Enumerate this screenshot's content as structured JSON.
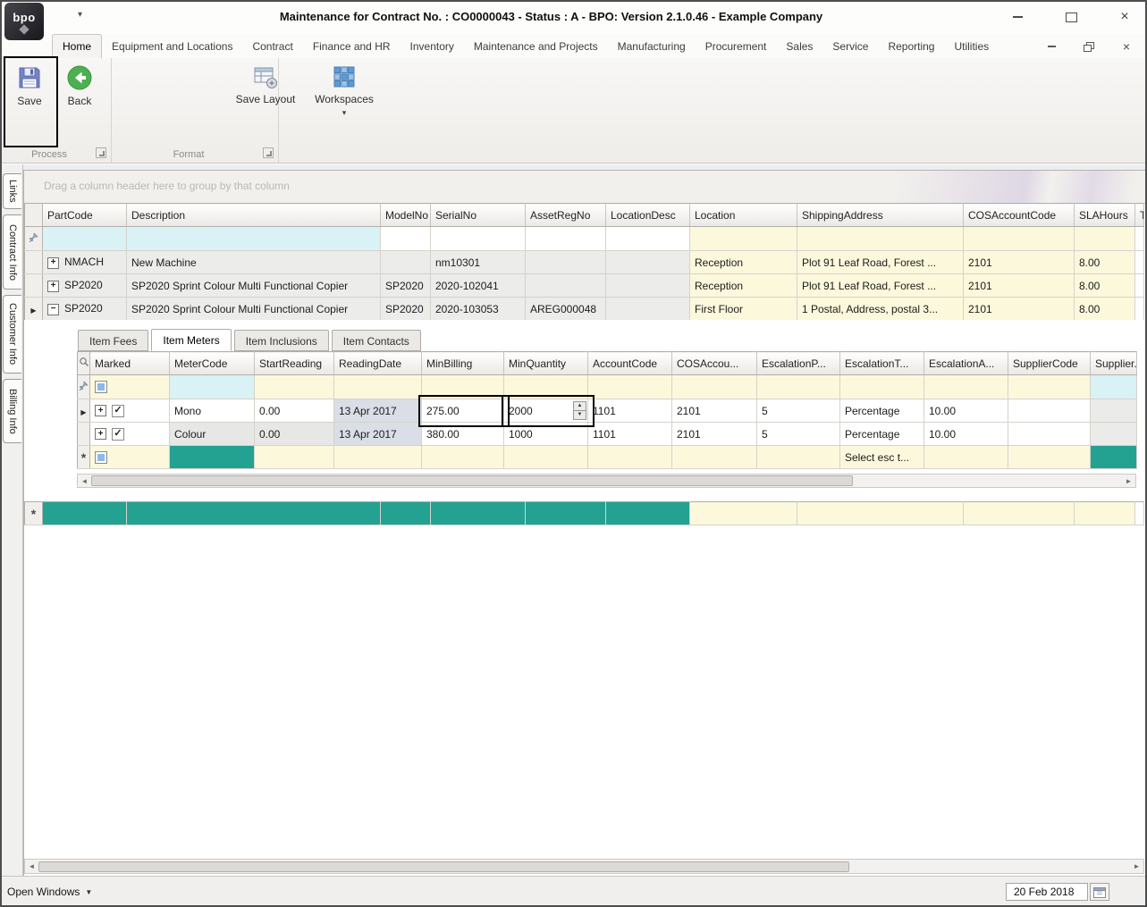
{
  "window": {
    "title": "Maintenance for Contract No. : CO0000043 - Status : A - BPO: Version 2.1.0.46 - Example Company",
    "logo_text": "bpo"
  },
  "ribbon": {
    "tabs": [
      "Home",
      "Equipment and Locations",
      "Contract",
      "Finance and HR",
      "Inventory",
      "Maintenance and Projects",
      "Manufacturing",
      "Procurement",
      "Sales",
      "Service",
      "Reporting",
      "Utilities"
    ],
    "buttons": {
      "save": "Save",
      "back": "Back",
      "save_layout": "Save Layout",
      "workspaces": "Workspaces"
    },
    "groups": {
      "process": "Process",
      "format": "Format"
    }
  },
  "sidebar": {
    "tabs": [
      "Links",
      "Contract Info",
      "Customer Info",
      "Billing Info"
    ]
  },
  "grid": {
    "group_hint": "Drag a column header here to group by that column",
    "columns": [
      "PartCode",
      "Description",
      "ModelNo",
      "SerialNo",
      "AssetRegNo",
      "LocationDesc",
      "Location",
      "ShippingAddress",
      "COSAccountCode",
      "SLAHours",
      "T"
    ],
    "rows": [
      {
        "part_code": "NMACH",
        "description": "New Machine",
        "model_no": "",
        "serial_no": "nm10301",
        "asset_reg_no": "",
        "location_desc": "",
        "location": "Reception",
        "shipping_address": "Plot 91 Leaf Road, Forest ...",
        "cos_account_code": "2101",
        "sla_hours": "8.00"
      },
      {
        "part_code": "SP2020",
        "description": "SP2020 Sprint Colour Multi Functional Copier",
        "model_no": "SP2020",
        "serial_no": "2020-102041",
        "asset_reg_no": "",
        "location_desc": "",
        "location": "Reception",
        "shipping_address": "Plot 91 Leaf Road, Forest ...",
        "cos_account_code": "2101",
        "sla_hours": "8.00"
      },
      {
        "part_code": "SP2020",
        "description": "SP2020 Sprint Colour Multi Functional Copier",
        "model_no": "SP2020",
        "serial_no": "2020-103053",
        "asset_reg_no": "AREG000048",
        "location_desc": "",
        "location": "First Floor",
        "shipping_address": "1 Postal, Address, postal 3...",
        "cos_account_code": "2101",
        "sla_hours": "8.00"
      }
    ]
  },
  "detail": {
    "tabs": [
      "Item Fees",
      "Item Meters",
      "Item Inclusions",
      "Item Contacts"
    ],
    "active_tab": "Item Meters",
    "columns": [
      "Marked",
      "MeterCode",
      "StartReading",
      "ReadingDate",
      "MinBilling",
      "MinQuantity",
      "AccountCode",
      "COSAccou...",
      "EscalationP...",
      "EscalationT...",
      "EscalationA...",
      "SupplierCode",
      "Supplier..."
    ],
    "rows": [
      {
        "meter_code": "Mono",
        "start_reading": "0.00",
        "reading_date": "13 Apr 2017",
        "min_billing": "275.00",
        "min_quantity": "2000",
        "account_code": "1101",
        "cos_account_code": "2101",
        "escalation_percent": "5",
        "escalation_type": "Percentage",
        "escalation_amount": "10.00",
        "supplier_code": "",
        "supplier": ""
      },
      {
        "meter_code": "Colour",
        "start_reading": "0.00",
        "reading_date": "13 Apr 2017",
        "min_billing": "380.00",
        "min_quantity": "1000",
        "account_code": "1101",
        "cos_account_code": "2101",
        "escalation_percent": "5",
        "escalation_type": "Percentage",
        "escalation_amount": "10.00",
        "supplier_code": "",
        "supplier": ""
      }
    ],
    "new_row_text": "Select esc t..."
  },
  "statusbar": {
    "open_windows_label": "Open Windows",
    "date_value": "20 Feb 2018"
  },
  "icons": {
    "check": "✓",
    "expand_collapsed": "+",
    "expand_expanded": "−",
    "row_arrow": "▶",
    "new_row_marker": "*",
    "dropdown_caret": "▾",
    "spin_up": "▲",
    "spin_down": "▼",
    "close": "×",
    "open_windows_caret": "▼",
    "scroll_left": "◄",
    "scroll_right": "►"
  },
  "colors": {
    "teal": "#23A292",
    "pale_yellow": "#FCF8DC",
    "pale_cyan": "#D9F2F6",
    "focus_cell": "#D9DEE7",
    "back_green": "#4CB050",
    "save_blue": "#7583C6"
  }
}
